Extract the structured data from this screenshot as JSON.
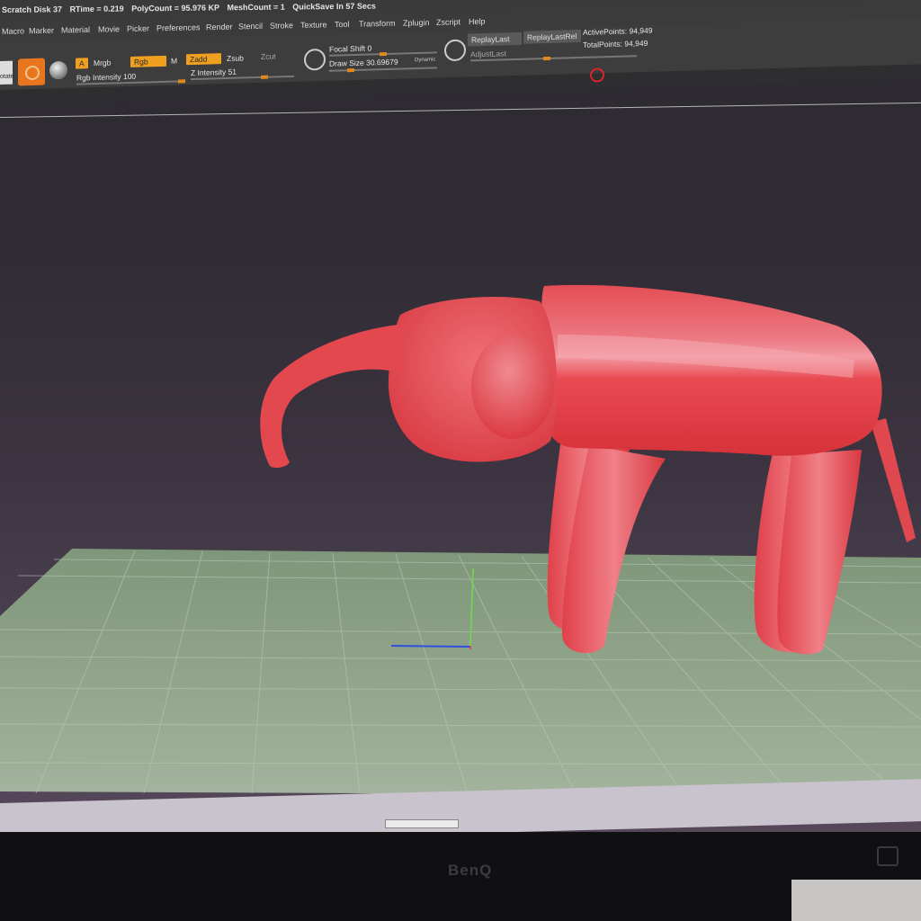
{
  "status_bar": {
    "items": [
      "Scratch Disk 37",
      "RTime = 0.219",
      "PolyCount = 95.976 KP",
      "MeshCount = 1",
      "QuickSave In 57 Secs"
    ]
  },
  "menu": {
    "items": [
      "Macro",
      "Marker",
      "Material",
      "Movie",
      "Picker",
      "Preferences",
      "Render",
      "Stencil",
      "Stroke",
      "Texture",
      "Tool",
      "Transform",
      "Zplugin",
      "Zscript",
      "Help"
    ]
  },
  "toolbar": {
    "rotate_label": "otate",
    "a_label": "A",
    "mrgb_label": "Mrgb",
    "rgb_label": "Rgb",
    "m_label": "M",
    "zadd_label": "Zadd",
    "zsub_label": "Zsub",
    "zcut_label": "Zcut",
    "rgb_intensity": "Rgb Intensity 100",
    "z_intensity": "Z Intensity 51",
    "focal_shift": "Focal Shift 0",
    "draw_size": "Draw Size 30.69679",
    "dynamic_label": "Dynamic",
    "replay_last": "ReplayLast",
    "replay_last_rel": "ReplayLastRel",
    "adjust_last": "AdjustLast",
    "active_points": "ActivePoints: 94,949",
    "total_points": "TotalPoints: 94,949"
  },
  "model": {
    "color": "#e8424a",
    "subject": "elephant"
  },
  "floor": {
    "color": "#8ca08a"
  },
  "monitor": {
    "brand": "BenQ"
  },
  "colors": {
    "accent": "#f0a020",
    "background": "#2d2b31"
  }
}
